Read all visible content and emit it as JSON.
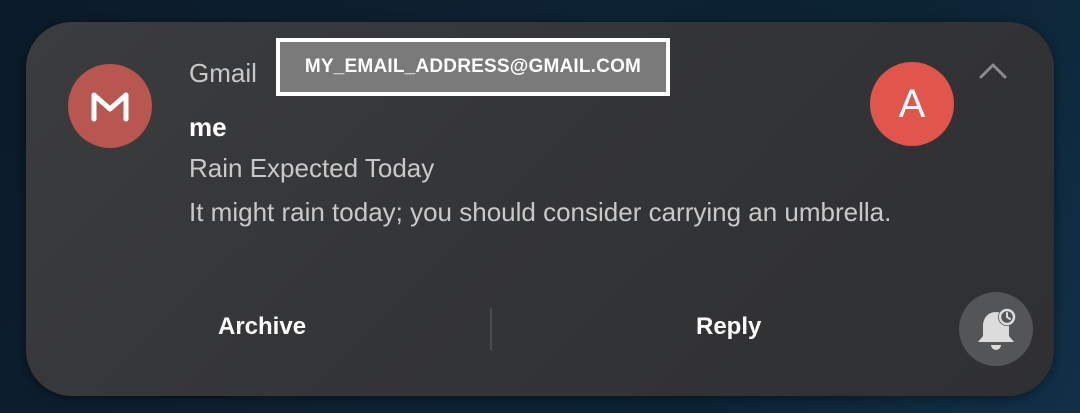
{
  "notification": {
    "app_name": "Gmail",
    "app_icon": "gmail-m-icon",
    "redacted_account": "MY_EMAIL_ADDRESS@GMAIL.COM",
    "sender": "me",
    "subject": "Rain Expected Today",
    "body": "It might rain today; you should consider carrying an umbrella.",
    "avatar_letter": "A",
    "expand_icon": "chevron-up-icon"
  },
  "actions": {
    "archive_label": "Archive",
    "reply_label": "Reply",
    "snooze_icon": "bell-snooze-icon"
  },
  "colors": {
    "app_icon_bg": "#b85650",
    "avatar_bg": "#e0554c",
    "card_bg": "#38393b",
    "text_primary": "#ffffff",
    "text_secondary": "#c9c9c9"
  }
}
